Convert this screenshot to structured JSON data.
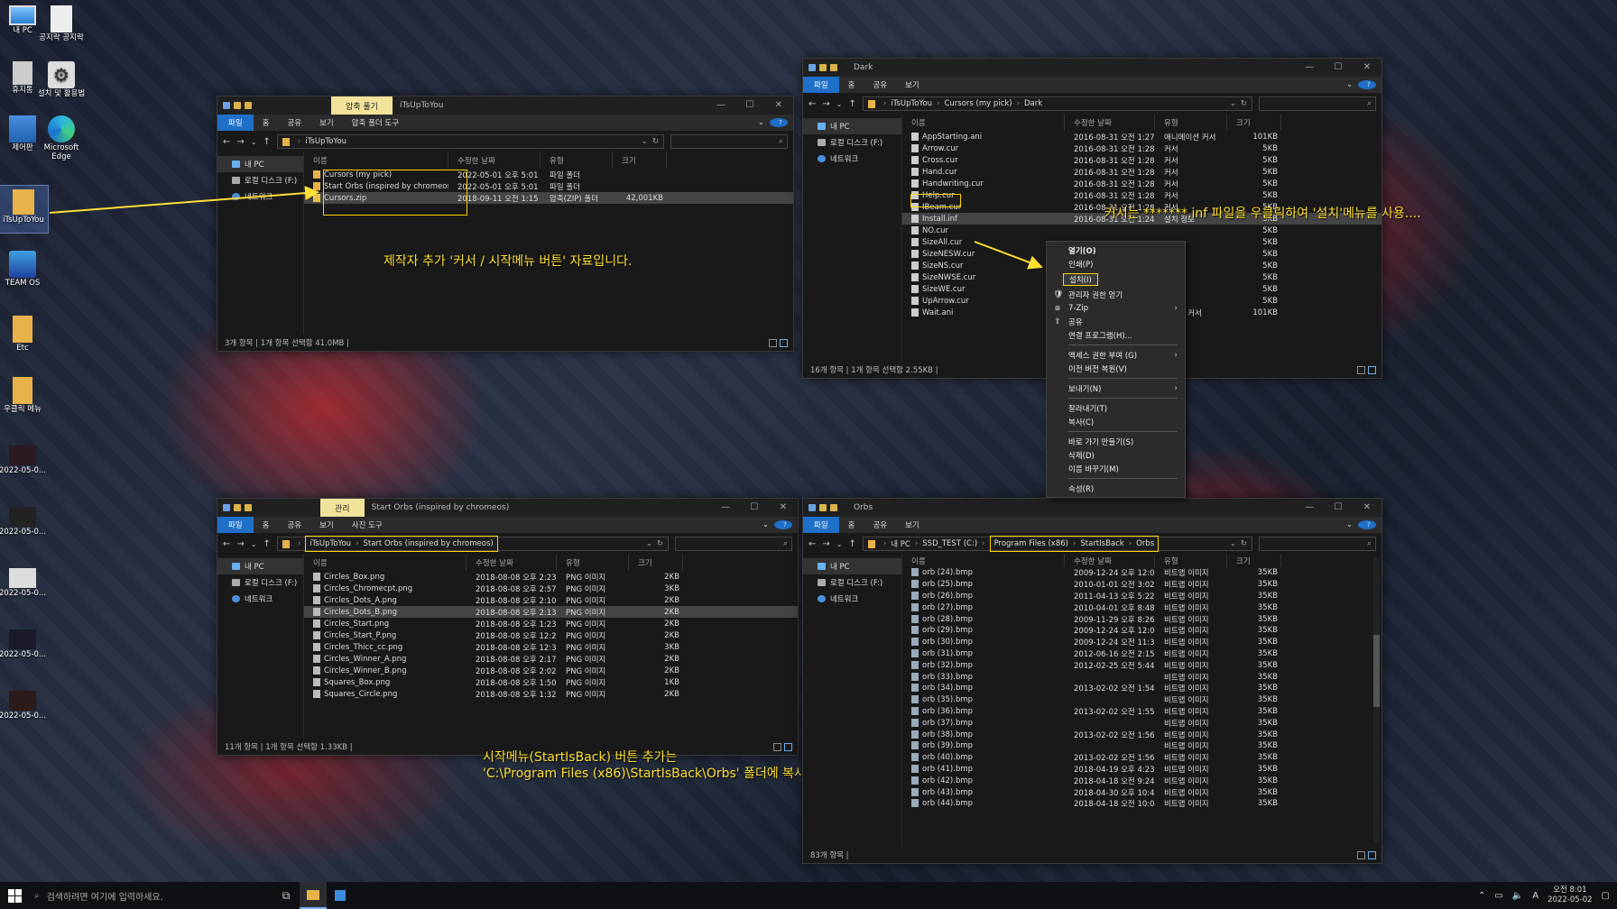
{
  "desktop": {
    "icons": [
      "내 PC",
      "공지락 공지락",
      "휴지통",
      "설치 및 활용법",
      "제어판",
      "Microsoft Edge",
      "iTsUpToYou",
      "TEAM OS",
      "Etc",
      "우클릭 메뉴",
      "2022-05-0...",
      "2022-05-0...",
      "2022-05-0...",
      "2022-05-0...",
      "2022-05-0..."
    ]
  },
  "win1": {
    "ctx_tab": "압축 풀기",
    "title": "iTsUpToYou",
    "ribbon": [
      "파일",
      "홈",
      "공유",
      "보기",
      "압축 폴더 도구"
    ],
    "path": [
      "iTsUpToYou"
    ],
    "nav": [
      "내 PC",
      "로컬 디스크 (F:)",
      "네트워크"
    ],
    "cols": [
      "이름",
      "수정한 날짜",
      "유형",
      "크기"
    ],
    "rows": [
      [
        "Cursors (my pick)",
        "2022-05-01 오후 5:01",
        "파일 폴더",
        ""
      ],
      [
        "Start Orbs (inspired by chromeos)",
        "2022-05-01 오후 5:01",
        "파일 폴더",
        ""
      ],
      [
        "Cursors.zip",
        "2018-09-11 오전 1:15",
        "압축(ZIP) 폴더",
        "42,001KB"
      ]
    ],
    "status": "3개 항목  |  1개 항목 선택함 41.0MB  |"
  },
  "win2": {
    "title": "Dark",
    "ribbon": [
      "파일",
      "홈",
      "공유",
      "보기"
    ],
    "path": [
      "iTsUpToYou",
      "Cursors (my pick)",
      "Dark"
    ],
    "nav": [
      "내 PC",
      "로컬 디스크 (F:)",
      "네트워크"
    ],
    "cols": [
      "이름",
      "수정한 날짜",
      "유형",
      "크기"
    ],
    "rows": [
      [
        "AppStarting.ani",
        "2016-08-31 오전 1:27",
        "애니메이션 커서",
        "101KB"
      ],
      [
        "Arrow.cur",
        "2016-08-31 오전 1:28",
        "커서",
        "5KB"
      ],
      [
        "Cross.cur",
        "2016-08-31 오전 1:28",
        "커서",
        "5KB"
      ],
      [
        "Hand.cur",
        "2016-08-31 오전 1:28",
        "커서",
        "5KB"
      ],
      [
        "Handwriting.cur",
        "2016-08-31 오전 1:28",
        "커서",
        "5KB"
      ],
      [
        "Help.cur",
        "2016-08-31 오전 1:28",
        "커서",
        "5KB"
      ],
      [
        "IBeam.cur",
        "2016-08-31 오전 1:28",
        "커서",
        "5KB"
      ],
      [
        "Install.inf",
        "2016-08-31 오전 1:24",
        "설치 정보",
        "3KB"
      ],
      [
        "NO.cur",
        "",
        "",
        "5KB"
      ],
      [
        "SizeAll.cur",
        "",
        "",
        "5KB"
      ],
      [
        "SizeNESW.cur",
        "",
        "",
        "5KB"
      ],
      [
        "SizeNS.cur",
        "",
        "",
        "5KB"
      ],
      [
        "SizeNWSE.cur",
        "",
        "",
        "5KB"
      ],
      [
        "SizeWE.cur",
        "",
        "",
        "5KB"
      ],
      [
        "UpArrow.cur",
        "",
        "",
        "5KB"
      ],
      [
        "Wait.ani",
        "",
        "메이션 커서",
        "101KB"
      ]
    ],
    "status": "16개 항목  |  1개 항목 선택함 2.55KB  |"
  },
  "menu": [
    {
      "t": "열기(O)",
      "b": true
    },
    {
      "t": "인쇄(P)"
    },
    {
      "t": "설치(I)",
      "hl": true
    },
    {
      "t": "관리자 권한 얻기",
      "ic": "shield"
    },
    {
      "t": "7-Zip",
      "arr": true,
      "ic": "7z"
    },
    {
      "t": "공유",
      "ic": "share"
    },
    {
      "t": "연결 프로그램(H)..."
    },
    {
      "sep": true
    },
    {
      "t": "액세스 권한 부여 (G)",
      "arr": true
    },
    {
      "t": "이전 버전 복원(V)"
    },
    {
      "sep": true
    },
    {
      "t": "보내기(N)",
      "arr": true
    },
    {
      "sep": true
    },
    {
      "t": "잘라내기(T)"
    },
    {
      "t": "복사(C)"
    },
    {
      "sep": true
    },
    {
      "t": "바로 가기 만들기(S)"
    },
    {
      "t": "삭제(D)"
    },
    {
      "t": "이름 바꾸기(M)"
    },
    {
      "sep": true
    },
    {
      "t": "속성(R)"
    }
  ],
  "win3": {
    "ctx_tab": "관리",
    "title": "Start Orbs (inspired by chromeos)",
    "ribbon": [
      "파일",
      "홈",
      "공유",
      "보기",
      "사진 도구"
    ],
    "path": [
      "iTsUpToYou",
      "Start Orbs (inspired by chromeos)"
    ],
    "nav": [
      "내 PC",
      "로컬 디스크 (F:)",
      "네트워크"
    ],
    "cols": [
      "이름",
      "수정한 날짜",
      "유형",
      "크기"
    ],
    "rows": [
      [
        "Circles_Box.png",
        "2018-08-08 오후 2:23",
        "PNG 이미지",
        "2KB"
      ],
      [
        "Circles_Chromecpt.png",
        "2018-08-08 오후 2:57",
        "PNG 이미지",
        "3KB"
      ],
      [
        "Circles_Dots_A.png",
        "2018-08-08 오후 2:10",
        "PNG 이미지",
        "2KB"
      ],
      [
        "Circles_Dots_B.png",
        "2018-08-08 오후 2:13",
        "PNG 이미지",
        "2KB"
      ],
      [
        "Circles_Start.png",
        "2018-08-08 오후 1:23",
        "PNG 이미지",
        "2KB"
      ],
      [
        "Circles_Start_P.png",
        "2018-08-08 오후 12:23",
        "PNG 이미지",
        "2KB"
      ],
      [
        "Circles_Thicc_cc.png",
        "2018-08-08 오후 12:35",
        "PNG 이미지",
        "3KB"
      ],
      [
        "Circles_Winner_A.png",
        "2018-08-08 오후 2:17",
        "PNG 이미지",
        "2KB"
      ],
      [
        "Circles_Winner_B.png",
        "2018-08-08 오후 2:02",
        "PNG 이미지",
        "2KB"
      ],
      [
        "Squares_Box.png",
        "2018-08-08 오후 1:50",
        "PNG 이미지",
        "1KB"
      ],
      [
        "Squares_Circle.png",
        "2018-08-08 오후 1:32",
        "PNG 이미지",
        "2KB"
      ]
    ],
    "status": "11개 항목  |  1개 항목 선택함 1.33KB  |"
  },
  "win4": {
    "title": "Orbs",
    "ribbon": [
      "파일",
      "홈",
      "공유",
      "보기"
    ],
    "path": [
      "내 PC",
      "SSD_TEST (C:)",
      "Program Files (x86)",
      "StartIsBack",
      "Orbs"
    ],
    "nav": [
      "내 PC",
      "로컬 디스크 (F:)",
      "네트워크"
    ],
    "cols": [
      "이름",
      "수정한 날짜",
      "유형",
      "크기"
    ],
    "rows": [
      [
        "orb (24).bmp",
        "2009-12-24 오후 12:00",
        "비트맵 이미지",
        "35KB"
      ],
      [
        "orb (25).bmp",
        "2010-01-01 오전 3:02",
        "비트맵 이미지",
        "35KB"
      ],
      [
        "orb (26).bmp",
        "2011-04-13 오후 5:22",
        "비트맵 이미지",
        "35KB"
      ],
      [
        "orb (27).bmp",
        "2010-04-01 오후 8:48",
        "비트맵 이미지",
        "35KB"
      ],
      [
        "orb (28).bmp",
        "2009-11-29 오후 8:26",
        "비트맵 이미지",
        "35KB"
      ],
      [
        "orb (29).bmp",
        "2009-12-24 오후 12:00",
        "비트맵 이미지",
        "35KB"
      ],
      [
        "orb (30).bmp",
        "2009-12-24 오전 11:37",
        "비트맵 이미지",
        "35KB"
      ],
      [
        "orb (31).bmp",
        "2012-06-16 오전 2:15",
        "비트맵 이미지",
        "35KB"
      ],
      [
        "orb (32).bmp",
        "2012-02-25 오전 5:44",
        "비트맵 이미지",
        "35KB"
      ],
      [
        "orb (33).bmp",
        "",
        "비트맵 이미지",
        "35KB"
      ],
      [
        "orb (34).bmp",
        "2013-02-02 오전 1:54",
        "비트맵 이미지",
        "35KB"
      ],
      [
        "orb (35).bmp",
        "",
        "비트맵 이미지",
        "35KB"
      ],
      [
        "orb (36).bmp",
        "2013-02-02 오전 1:55",
        "비트맵 이미지",
        "35KB"
      ],
      [
        "orb (37).bmp",
        "",
        "비트맵 이미지",
        "35KB"
      ],
      [
        "orb (38).bmp",
        "2013-02-02 오전 1:56",
        "비트맵 이미지",
        "35KB"
      ],
      [
        "orb (39).bmp",
        "",
        "비트맵 이미지",
        "35KB"
      ],
      [
        "orb (40).bmp",
        "2013-02-02 오전 1:56",
        "비트맵 이미지",
        "35KB"
      ],
      [
        "orb (41).bmp",
        "2018-04-19 오후 4:23",
        "비트맵 이미지",
        "35KB"
      ],
      [
        "orb (42).bmp",
        "2018-04-18 오전 9:24",
        "비트맵 이미지",
        "35KB"
      ],
      [
        "orb (43).bmp",
        "2018-04-30 오후 10:49",
        "비트맵 이미지",
        "35KB"
      ],
      [
        "orb (44).bmp",
        "2018-04-18 오전 10:08",
        "비트맵 이미지",
        "35KB"
      ]
    ],
    "status": "83개 항목  |"
  },
  "annotations": {
    "a1": "제작자 추가 '커서 / 시작메뉴 버튼' 자료입니다.",
    "a2": "커서는 *******.inf 파일을 우클릭하여 '설치'메뉴를 사용....",
    "a3a": "시작메뉴(StartIsBack) 버튼 추가는",
    "a3b": "'C:\\Program Files (x86)\\StartIsBack\\Orbs' 폴더에 복사하여 사용...."
  },
  "taskbar": {
    "search_placeholder": "검색하려면 여기에 입력하세요.",
    "time": "오전 8:01",
    "date": "2022-05-02",
    "ime": "A"
  }
}
